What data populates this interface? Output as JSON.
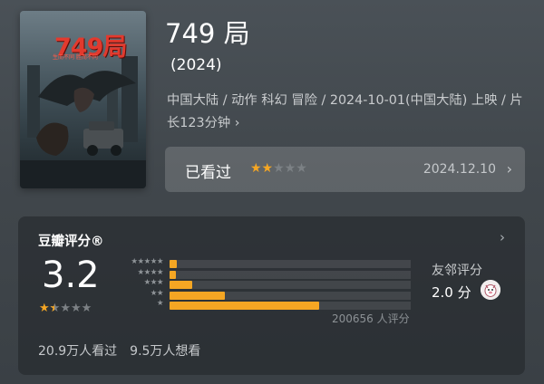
{
  "poster": {
    "title": "749局",
    "tagline": "生而不同  胜而不同"
  },
  "movie": {
    "title": "749 局",
    "year": "(2024)",
    "meta": "中国大陆 / 动作 科幻 冒险 / 2024-10-01(中国大陆) 上映 / 片长123分钟",
    "meta_chevron": "›"
  },
  "watched": {
    "label": "已看过",
    "stars_on": "★★",
    "stars_off": "★★★",
    "user_rating": 2,
    "date": "2024.12.10",
    "chevron": "›"
  },
  "rating": {
    "title": "豆瓣评分®",
    "chevron": "›",
    "score": "3.2",
    "score_stars_on": "★",
    "score_stars_off": "★★★",
    "rating_count": "200656 人评分",
    "distribution": [
      {
        "stars": "★★★★★",
        "fraction": 0.03
      },
      {
        "stars": "★★★★",
        "fraction": 0.025
      },
      {
        "stars": "★★★",
        "fraction": 0.095
      },
      {
        "stars": "★★",
        "fraction": 0.23
      },
      {
        "stars": "★",
        "fraction": 0.62
      }
    ],
    "friend_label": "友邻评分",
    "friend_score": "2.0 分",
    "watched_count": "20.9万人看过",
    "wish_count": "9.5万人想看"
  },
  "colors": {
    "accent": "#f5a623",
    "star_off": "#7c8185",
    "poster_title": "#e23a2e"
  }
}
